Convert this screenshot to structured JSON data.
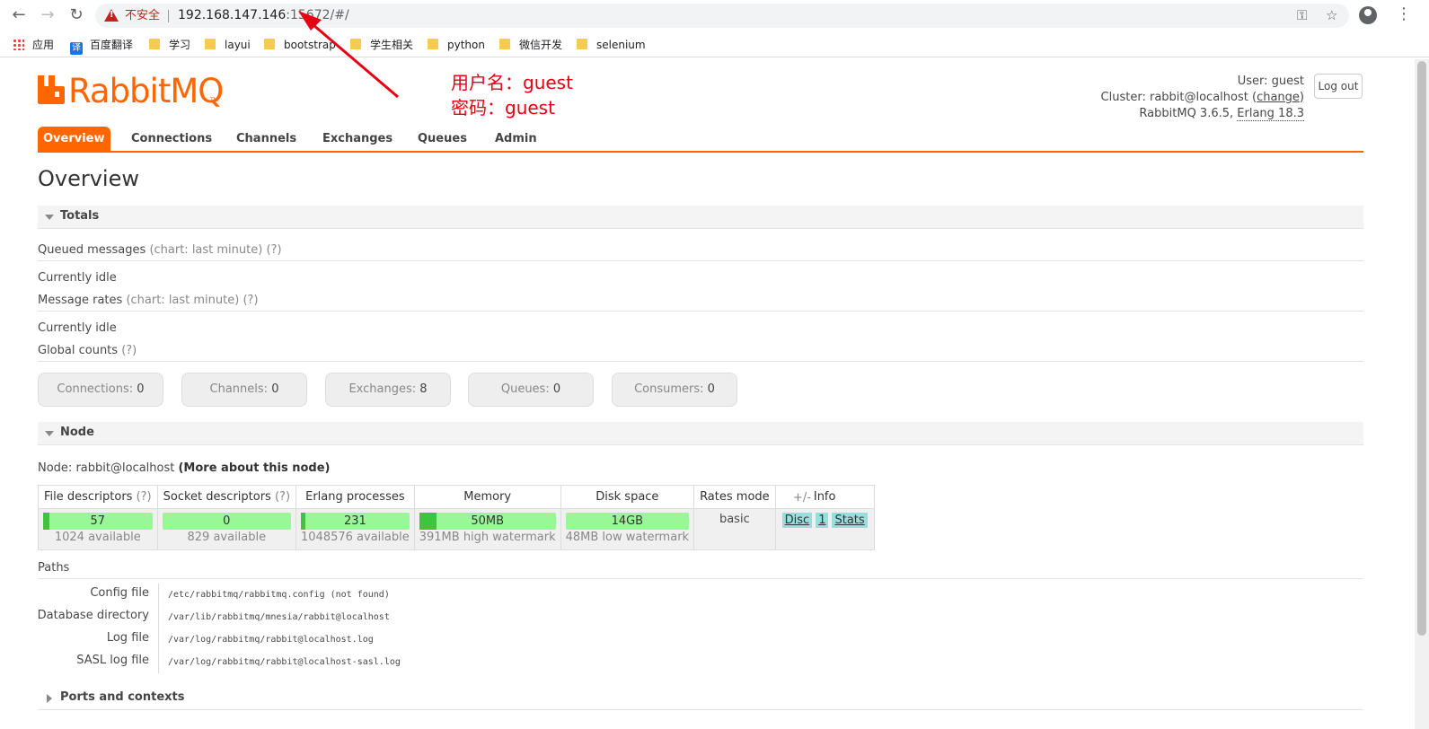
{
  "browser": {
    "insecure_label": "不安全",
    "url_host": "192.168.147.146",
    "url_rest": ":15672/#/",
    "bookmarks": [
      "应用",
      "百度翻译",
      "学习",
      "layui",
      "bootstrap",
      "学生相关",
      "python",
      "微信开发",
      "selenium"
    ],
    "bookmark_translate_glyph": "译"
  },
  "header": {
    "logo_text": "RabbitMQ",
    "logo_tm": "TM",
    "annotation_line1": "用户名：guest",
    "annotation_line2": "密码：guest",
    "user_label": "User:",
    "user_value": "guest",
    "cluster_label": "Cluster:",
    "cluster_value": "rabbit@localhost",
    "change_link": "change",
    "version_text": "RabbitMQ 3.6.5,",
    "erlang_text": "Erlang 18.3",
    "logout_label": "Log out"
  },
  "tabs": [
    {
      "label": "Overview",
      "active": true
    },
    {
      "label": "Connections"
    },
    {
      "label": "Channels"
    },
    {
      "label": "Exchanges"
    },
    {
      "label": "Queues"
    },
    {
      "label": "Admin"
    }
  ],
  "page_title": "Overview",
  "totals": {
    "section_label": "Totals",
    "queued_label": "Queued messages",
    "queued_hint": "(chart: last minute)",
    "help": "(?)",
    "idle1": "Currently idle",
    "rates_label": "Message rates",
    "rates_hint": "(chart: last minute)",
    "idle2": "Currently idle",
    "global_label": "Global counts",
    "counts": [
      {
        "label": "Connections:",
        "value": "0"
      },
      {
        "label": "Channels:",
        "value": "0"
      },
      {
        "label": "Exchanges:",
        "value": "8"
      },
      {
        "label": "Queues:",
        "value": "0"
      },
      {
        "label": "Consumers:",
        "value": "0"
      }
    ]
  },
  "node": {
    "section_label": "Node",
    "node_label": "Node:",
    "node_value": "rabbit@localhost",
    "more_link": "(More about this node)",
    "columns": [
      "File descriptors",
      "Socket descriptors",
      "Erlang processes",
      "Memory",
      "Disk space",
      "Rates mode",
      "Info"
    ],
    "help": "(?)",
    "file_descriptors": {
      "value": "57",
      "sub": "1024 available",
      "fill": 0.056
    },
    "socket_descriptors": {
      "value": "0",
      "sub": "829 available",
      "fill": 0.0
    },
    "erlang_processes": {
      "value": "231",
      "sub": "1048576 available",
      "fill": 0.0002
    },
    "memory": {
      "value": "50MB",
      "sub": "391MB high watermark",
      "fill": 0.13
    },
    "disk_space": {
      "value": "14GB",
      "sub": "48MB low watermark",
      "fill": 1.0
    },
    "rates_mode": "basic",
    "info_buttons": [
      "Disc",
      "1",
      "Stats"
    ],
    "plus_minus": "+/-"
  },
  "paths": {
    "label": "Paths",
    "rows": [
      {
        "key": "Config file",
        "value": "/etc/rabbitmq/rabbitmq.config (not found)"
      },
      {
        "key": "Database directory",
        "value": "/var/lib/rabbitmq/mnesia/rabbit@localhost"
      },
      {
        "key": "Log file",
        "value": "/var/log/rabbitmq/rabbit@localhost.log"
      },
      {
        "key": "SASL log file",
        "value": "/var/log/rabbitmq/rabbit@localhost-sasl.log"
      }
    ]
  },
  "ports": {
    "section_label": "Ports and contexts"
  },
  "colors": {
    "accent": "#ff6600",
    "annotation": "#e60012",
    "bar": "#98f898",
    "bar_fill": "#3ec43e"
  }
}
